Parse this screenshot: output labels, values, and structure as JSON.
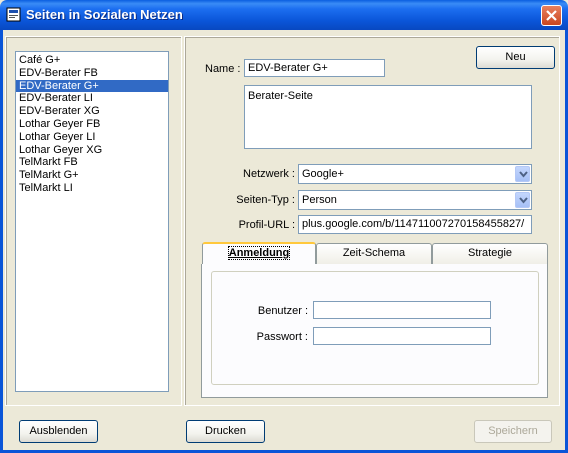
{
  "window": {
    "title": "Seiten in Sozialen Netzen"
  },
  "pages": [
    {
      "label": "Café G+",
      "selected": false
    },
    {
      "label": "EDV-Berater FB",
      "selected": false
    },
    {
      "label": "EDV-Berater G+",
      "selected": true
    },
    {
      "label": "EDV-Berater LI",
      "selected": false
    },
    {
      "label": "EDV-Berater XG",
      "selected": false
    },
    {
      "label": "Lothar Geyer FB",
      "selected": false
    },
    {
      "label": "Lothar Geyer LI",
      "selected": false
    },
    {
      "label": "Lothar Geyer XG",
      "selected": false
    },
    {
      "label": "TelMarkt FB",
      "selected": false
    },
    {
      "label": "TelMarkt G+",
      "selected": false
    },
    {
      "label": "TelMarkt LI",
      "selected": false
    }
  ],
  "form": {
    "new_button": "Neu",
    "name_label": "Name :",
    "name_value": "EDV-Berater G+",
    "description": "Berater-Seite",
    "network_label": "Netzwerk :",
    "network_value": "Google+",
    "type_label": "Seiten-Typ :",
    "type_value": "Person",
    "url_label": "Profil-URL :",
    "url_value": "plus.google.com/b/114711007270158455827/"
  },
  "tabs": [
    {
      "label": "Anmeldung",
      "active": true
    },
    {
      "label": "Zeit-Schema",
      "active": false
    },
    {
      "label": "Strategie",
      "active": false
    }
  ],
  "login": {
    "user_label": "Benutzer :",
    "user_value": "",
    "password_label": "Passwort :",
    "password_value": ""
  },
  "footer": {
    "hide_button": "Ausblenden",
    "print_button": "Drucken",
    "save_button": "Speichern",
    "save_enabled": false
  },
  "colors": {
    "title_bar": "#0a55d8",
    "selection": "#316ac5",
    "window_bg": "#ece9d8",
    "tab_highlight": "#ffc83c"
  }
}
